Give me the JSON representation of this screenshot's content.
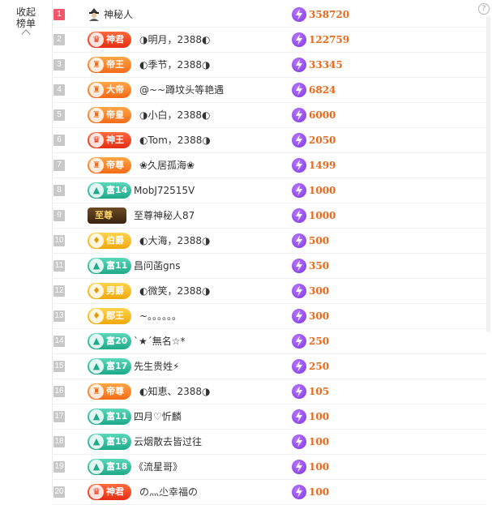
{
  "sidebar": {
    "collapse_label": "收起榜单"
  },
  "help": {
    "symbol": "?"
  },
  "colors": {
    "value_text": "#e8691b",
    "top_rank": "#f0566b",
    "rank": "#c8c8c8"
  },
  "rows": [
    {
      "rank": "1",
      "badge": "",
      "badge_style": "avatar",
      "name": "神秘人",
      "value": "358720"
    },
    {
      "rank": "2",
      "badge": "神君",
      "badge_style": "red",
      "name": "◑明月，2388◐",
      "value": "122759"
    },
    {
      "rank": "3",
      "badge": "帝王",
      "badge_style": "orange",
      "name": "◐季节，2388◑",
      "value": "33345"
    },
    {
      "rank": "4",
      "badge": "大帝",
      "badge_style": "orange",
      "name": "@~~蹲坟头等艳遇",
      "value": "6824"
    },
    {
      "rank": "5",
      "badge": "帝皇",
      "badge_style": "orange",
      "name": "◑小白，2388◐",
      "value": "6000"
    },
    {
      "rank": "6",
      "badge": "神王",
      "badge_style": "red",
      "name": "◐Tom，2388◑",
      "value": "2050"
    },
    {
      "rank": "7",
      "badge": "帝尊",
      "badge_style": "orange",
      "name": "❀久居孤海❀",
      "value": "1499"
    },
    {
      "rank": "8",
      "badge": "富14",
      "badge_style": "green",
      "name": "MobJ72515V",
      "value": "1000"
    },
    {
      "rank": "9",
      "badge": "至尊",
      "badge_style": "dark",
      "name": "至尊神秘人87",
      "value": "1000"
    },
    {
      "rank": "10",
      "badge": "伯爵",
      "badge_style": "gold",
      "name": "◐大海，2388◑",
      "value": "500"
    },
    {
      "rank": "11",
      "badge": "富11",
      "badge_style": "green",
      "name": "昌问菡gns",
      "value": "350"
    },
    {
      "rank": "12",
      "badge": "男爵",
      "badge_style": "gold",
      "name": "◐微笑，2388◑",
      "value": "300"
    },
    {
      "rank": "13",
      "badge": "郡王",
      "badge_style": "gold",
      "name": "~。。。。。。",
      "value": "300"
    },
    {
      "rank": "14",
      "badge": "富20",
      "badge_style": "green",
      "name": "ˋ★ˊ無名☆*",
      "value": "250"
    },
    {
      "rank": "15",
      "badge": "富17",
      "badge_style": "green",
      "name": "先生贵姓⚡",
      "value": "250"
    },
    {
      "rank": "16",
      "badge": "帝尊",
      "badge_style": "orange",
      "name": "◐知恵、2388◑",
      "value": "105"
    },
    {
      "rank": "17",
      "badge": "富11",
      "badge_style": "green",
      "name": "四月♡忻麟",
      "value": "100"
    },
    {
      "rank": "18",
      "badge": "富19",
      "badge_style": "green",
      "name": "云烟散去皆过往",
      "value": "100"
    },
    {
      "rank": "19",
      "badge": "富18",
      "badge_style": "green",
      "name": "《流星哥》",
      "value": "100"
    },
    {
      "rank": "20",
      "badge": "神君",
      "badge_style": "red",
      "name": "の灬尐幸福の",
      "value": "100"
    }
  ]
}
